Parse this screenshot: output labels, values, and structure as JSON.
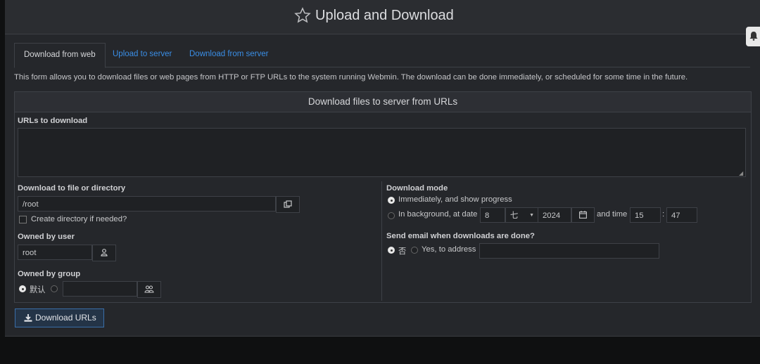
{
  "header": {
    "title": "Upload and Download",
    "star_icon": "star-icon"
  },
  "tabs": [
    {
      "label": "Download from web",
      "active": true
    },
    {
      "label": "Upload to server",
      "active": false
    },
    {
      "label": "Download from server",
      "active": false
    }
  ],
  "description": "This form allows you to download files or web pages from HTTP or FTP URLs to the system running Webmin. The download can be done immediately, or scheduled for some time in the future.",
  "form": {
    "heading": "Download files to server from URLs",
    "urls_label": "URLs to download",
    "urls_value": "",
    "dest_label": "Download to file or directory",
    "dest_value": "/root",
    "mkdir_label": "Create directory if needed?",
    "mkdir_checked": false,
    "user_label": "Owned by user",
    "user_value": "root",
    "group_label": "Owned by group",
    "group_default_label": "默认",
    "group_value": "",
    "mode_label": "Download mode",
    "mode_immediate_label": "Immediately, and show progress",
    "mode_background_label": "In background, at date",
    "mode_selected": "immediate",
    "date_day": "8",
    "date_month": "七",
    "date_year": "2024",
    "and_time_label": "and time",
    "time_hour": "15",
    "time_colon": ":",
    "time_minute": "47",
    "email_label": "Send email when downloads are done?",
    "email_no_label": "否",
    "email_yes_label": "Yes, to address",
    "email_selected": "no",
    "email_value": ""
  },
  "submit_label": "Download URLs"
}
